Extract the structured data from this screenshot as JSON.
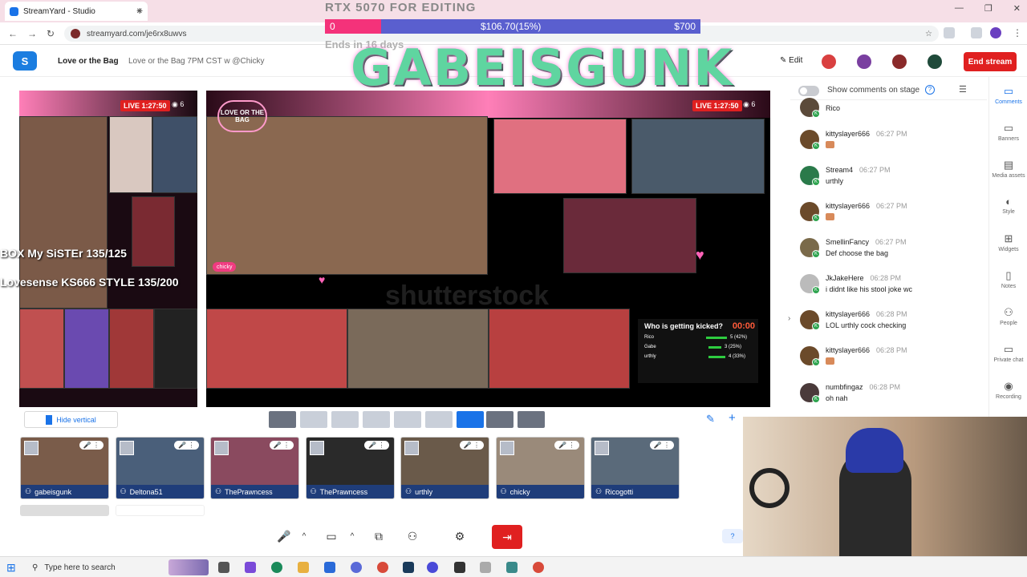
{
  "browser": {
    "tab_title": "StreamYard - Studio",
    "url": "streamyard.com/je6rx8uwvs",
    "new_tab": "+",
    "controls": {
      "minimize": "—",
      "maximize": "❐",
      "close": "✕"
    }
  },
  "header": {
    "breadcrumb_1": "Love or the Bag",
    "breadcrumb_2": "Love or the Bag 7PM CST w @Chicky",
    "edit_label": "Edit",
    "end_stream_label": "End stream"
  },
  "overlay": {
    "goal_title": "RTX 5070 FOR EDITING",
    "goal_start": "0",
    "goal_current": "$106.70(15%)",
    "goal_target": "$700",
    "goal_progress": 0.15,
    "ends_text": "Ends in 16 days",
    "brand_text": "GABEISGUNK",
    "left_line_1": "BOX My SiSTEr 135/125",
    "left_line_2": "Lovesense KS666 STYLE 135/200",
    "watermark": "shutterstock"
  },
  "stage": {
    "left_live": "LIVE 1:27:50",
    "left_viewers": "6",
    "main_live": "LIVE 1:27:50",
    "main_viewers": "6",
    "main_name": "chicky",
    "logo_text": "LOVE OR THE BAG"
  },
  "poll": {
    "title": "Who is getting kicked?",
    "timer": "00:00",
    "rows": [
      {
        "name": "Rico",
        "count": "5 (42%)",
        "pct": 0.42
      },
      {
        "name": "Gabe",
        "count": "3 (25%)",
        "pct": 0.25
      },
      {
        "name": "urthly",
        "count": "4 (33%)",
        "pct": 0.33
      }
    ]
  },
  "layout_bar": {
    "hide_vertical_label": "Hide vertical"
  },
  "guests": [
    {
      "name": "gabeisgunk",
      "color": "#7a5c4a"
    },
    {
      "name": "Deltona51",
      "color": "#4a5f7a"
    },
    {
      "name": "ThePrawncess",
      "color": "#8a4a5f"
    },
    {
      "name": "ThePrawncess",
      "color": "#2a2a2a"
    },
    {
      "name": "urthly",
      "color": "#6a5a4a"
    },
    {
      "name": "chicky",
      "color": "#9a8a7a"
    },
    {
      "name": "Ricogotti",
      "color": "#5a6a7a"
    }
  ],
  "comments_panel": {
    "show_label": "Show comments on stage",
    "comments": [
      {
        "name": "",
        "time": "",
        "text": "Rico",
        "color": "#5b4a3a",
        "emoji": false
      },
      {
        "name": "kittyslayer666",
        "time": "06:27 PM",
        "text": "",
        "color": "#6b4a2a",
        "emoji": true
      },
      {
        "name": "Stream4",
        "time": "06:27 PM",
        "text": "urthly",
        "color": "#2a7a4a",
        "emoji": false
      },
      {
        "name": "kittyslayer666",
        "time": "06:27 PM",
        "text": "",
        "color": "#6b4a2a",
        "emoji": true
      },
      {
        "name": "SmellinFancy",
        "time": "06:27 PM",
        "text": "Def choose the bag",
        "color": "#7a6a4a",
        "emoji": false
      },
      {
        "name": "JkJakeHere",
        "time": "06:28 PM",
        "text": "i didnt like his stool joke wc",
        "color": "#bbbbbb",
        "emoji": false
      },
      {
        "name": "kittyslayer666",
        "time": "06:28 PM",
        "text": "LOL urthly cock checking",
        "color": "#6b4a2a",
        "emoji": false
      },
      {
        "name": "kittyslayer666",
        "time": "06:28 PM",
        "text": "",
        "color": "#6b4a2a",
        "emoji": true
      },
      {
        "name": "numbfingaz",
        "time": "06:28 PM",
        "text": "oh nah",
        "color": "#4a3a3a",
        "emoji": false
      }
    ]
  },
  "rail": [
    {
      "label": "Comments",
      "icon": "▭"
    },
    {
      "label": "Banners",
      "icon": "▭"
    },
    {
      "label": "Media assets",
      "icon": "▤"
    },
    {
      "label": "Style",
      "icon": "◐"
    },
    {
      "label": "Widgets",
      "icon": "⊞"
    },
    {
      "label": "Notes",
      "icon": "▯"
    },
    {
      "label": "People",
      "icon": "⚇"
    },
    {
      "label": "Private chat",
      "icon": "▭"
    },
    {
      "label": "Recording",
      "icon": "◉"
    }
  ],
  "taskbar": {
    "search_placeholder": "Type here to search"
  },
  "colors": {
    "accent": "#1a73e8",
    "end_stream": "#e02020",
    "goal_fill": "#f4327a",
    "goal_bar": "#5a5fcf"
  }
}
